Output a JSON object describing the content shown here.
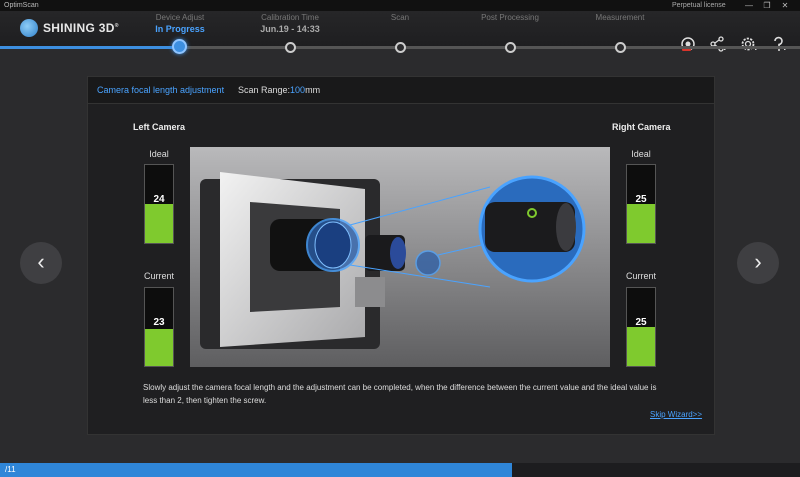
{
  "app": {
    "title": "OptimScan",
    "license": "Perpetual license",
    "window_buttons": [
      "—",
      "❐",
      "✕"
    ]
  },
  "logo": {
    "text": "SHINING 3D",
    "mark": "®"
  },
  "steps": [
    {
      "label": "Device Adjust",
      "sub": "In Progress"
    },
    {
      "label": "Calibration Time",
      "sub": "Jun.19 - 14:33"
    },
    {
      "label": "Scan",
      "sub": ""
    },
    {
      "label": "Post Processing",
      "sub": ""
    },
    {
      "label": "Measurement",
      "sub": ""
    }
  ],
  "toolbar_icons": [
    "camera-new-icon",
    "share-icon",
    "settings-icon",
    "help-icon"
  ],
  "panel": {
    "title": "Camera focal length adjustment",
    "scan_range_label": "Scan Range:",
    "scan_range_value": "100",
    "scan_range_unit": "mm",
    "left_camera": {
      "heading": "Left Camera",
      "ideal_label": "Ideal",
      "ideal_value": "24",
      "ideal_fill": 0.5,
      "current_label": "Current",
      "current_value": "23",
      "current_fill": 0.48
    },
    "right_camera": {
      "heading": "Right Camera",
      "ideal_label": "Ideal",
      "ideal_value": "25",
      "ideal_fill": 0.5,
      "current_label": "Current",
      "current_value": "25",
      "current_fill": 0.5
    },
    "instruction": "Slowly adjust the camera focal length and the adjustment can be completed, when the difference between the current value and the ideal value is less than 2, then tighten the screw.",
    "skip_label": "Skip Wizard>>"
  },
  "nav": {
    "prev": "‹",
    "next": "›"
  },
  "status": {
    "page": "/11",
    "progress": 0.64
  },
  "colors": {
    "accent": "#4aa3ff",
    "meter_green": "#7fca2e",
    "progress_blue": "#2f86d8"
  }
}
